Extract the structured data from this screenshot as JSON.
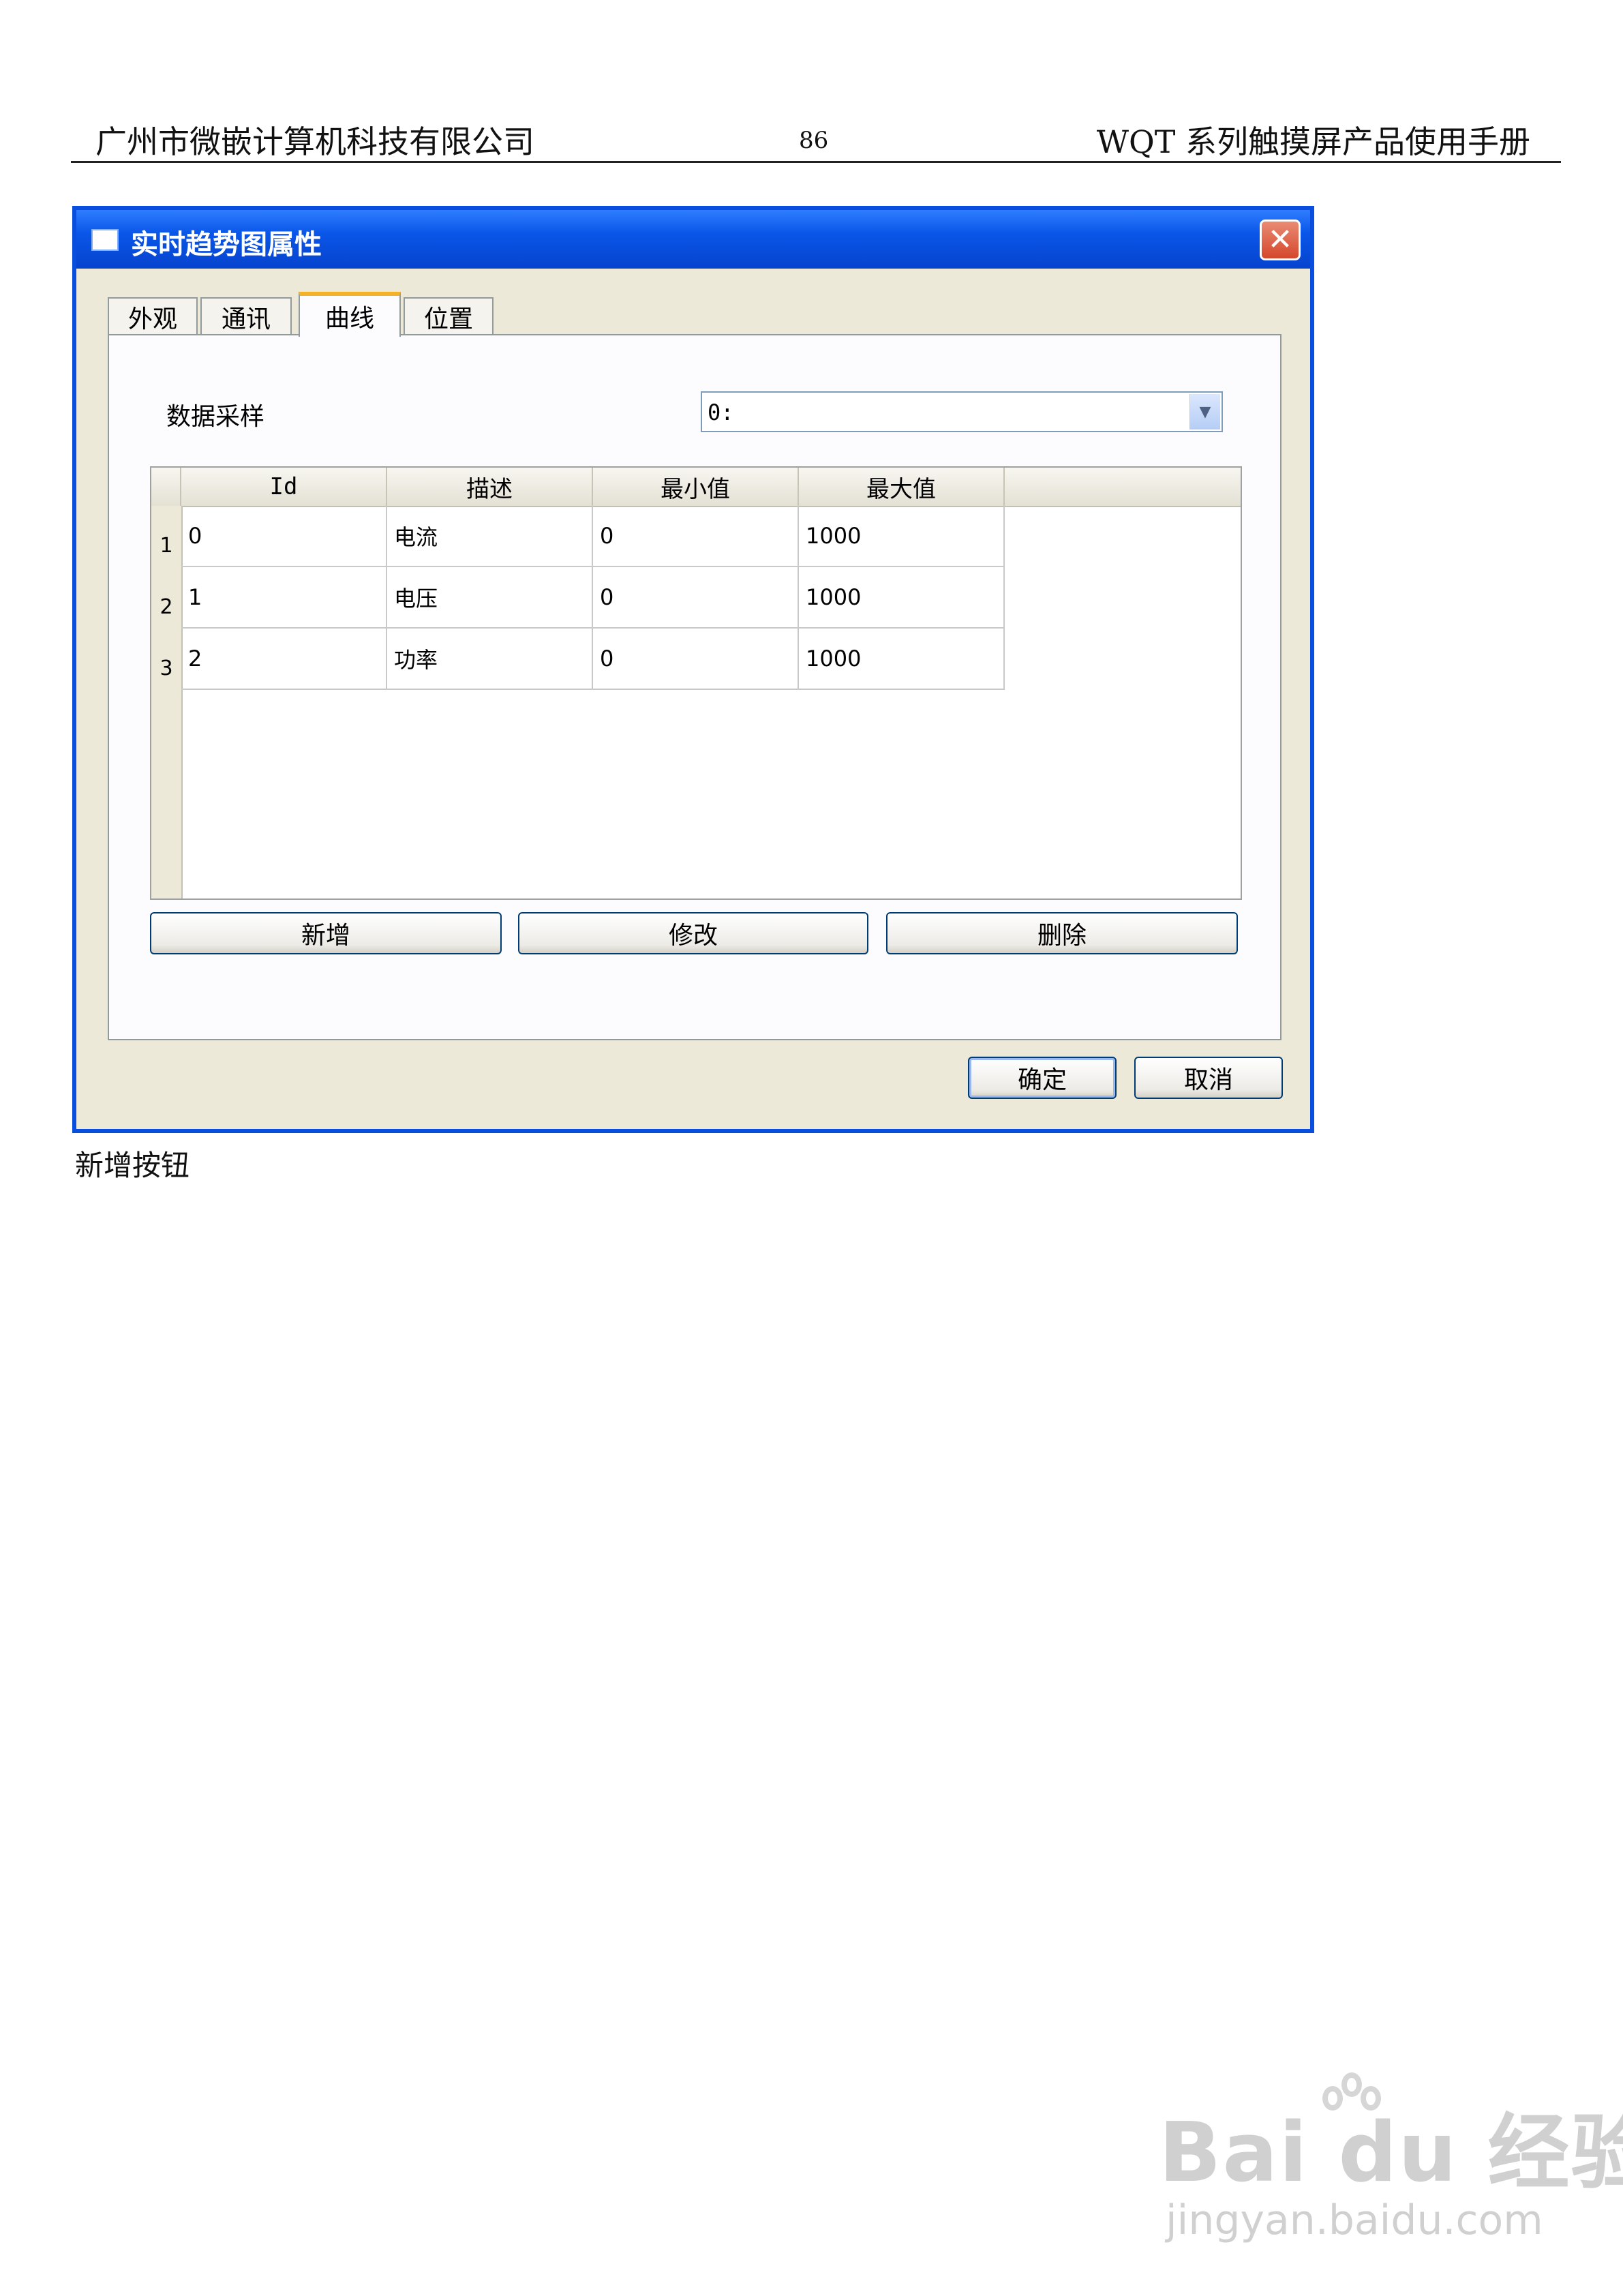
{
  "page_header": {
    "company": "广州市微嵌计算机科技有限公司",
    "page_number": "86",
    "manual_title": "WQT 系列触摸屏产品使用手册"
  },
  "dialog": {
    "title": "实时趋势图属性",
    "tabs": [
      {
        "label": "外观",
        "active": false
      },
      {
        "label": "通讯",
        "active": false
      },
      {
        "label": "曲线",
        "active": true
      },
      {
        "label": "位置",
        "active": false
      }
    ],
    "data_sample_label": "数据采样",
    "data_sample_value": "0:",
    "table": {
      "columns": [
        "Id",
        "描述",
        "最小值",
        "最大值"
      ],
      "rows": [
        {
          "index": "1",
          "cells": [
            "0",
            "电流",
            "0",
            "1000"
          ]
        },
        {
          "index": "2",
          "cells": [
            "1",
            "电压",
            "0",
            "1000"
          ]
        },
        {
          "index": "3",
          "cells": [
            "2",
            "功率",
            "0",
            "1000"
          ]
        }
      ]
    },
    "buttons": {
      "add": "新增",
      "modify": "修改",
      "delete": "删除",
      "ok": "确定",
      "cancel": "取消"
    }
  },
  "caption": "新增按钮",
  "watermark": {
    "brand": "Bai du 经验",
    "url": "jingyan.baidu.com"
  },
  "colors": {
    "titlebar": "#0a56e8",
    "window_bg": "#ece9d8",
    "active_tab_accent": "#f4b228",
    "close_button": "#d4472b"
  }
}
